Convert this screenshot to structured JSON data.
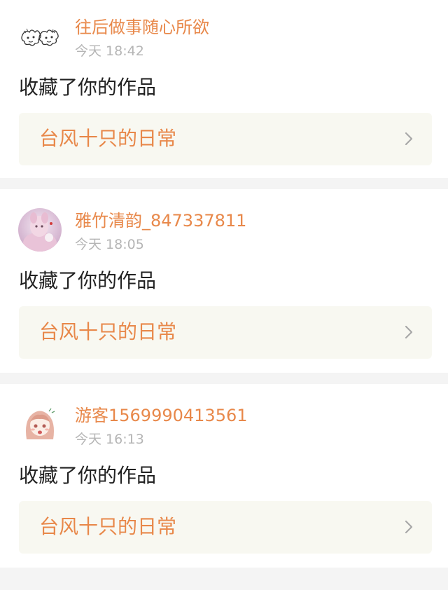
{
  "theme": {
    "accent": "#e8884a",
    "card_bg": "#f8f8f1",
    "chevron": "#a8a8a8"
  },
  "notifications": [
    {
      "avatar_icon": "doodle-avatar-icon",
      "username": "往后做事随心所欲",
      "timestamp": "今天 18:42",
      "action": "收藏了你的作品",
      "work_title": "台风十只的日常"
    },
    {
      "avatar_icon": "pink-costume-avatar-icon",
      "username": "雅竹清韵_847337811",
      "timestamp": "今天 18:05",
      "action": "收藏了你的作品",
      "work_title": "台风十只的日常"
    },
    {
      "avatar_icon": "anime-girl-avatar-icon",
      "username": "游客1569990413561",
      "timestamp": "今天 16:13",
      "action": "收藏了你的作品",
      "work_title": "台风十只的日常"
    }
  ]
}
